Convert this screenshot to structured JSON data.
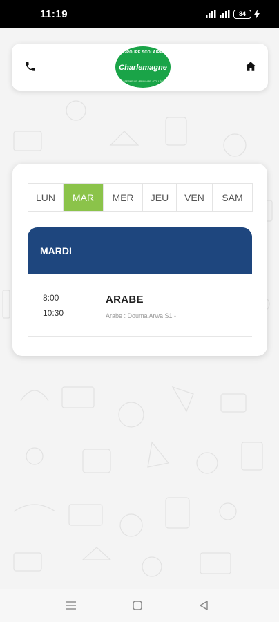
{
  "status_bar": {
    "time": "11:19",
    "battery": "84"
  },
  "header": {
    "logo": {
      "top_text": "GROUPE SCOLAIRE",
      "name": "Charlemagne",
      "bottom_text": "MATERNELLE · PRIMAIRE · COLLÈGE"
    },
    "icons": [
      "phone-icon",
      "home-icon"
    ]
  },
  "schedule": {
    "days": [
      "LUN",
      "MAR",
      "MER",
      "JEU",
      "VEN",
      "SAM"
    ],
    "active_day": "MAR",
    "day_title": "MARDI",
    "lessons": [
      {
        "start": "8:00",
        "end": "10:30",
        "subject": "ARABE",
        "detail": "Arabe : Douma Arwa S1 -"
      }
    ]
  },
  "colors": {
    "accent_green": "#8bc34a",
    "banner_blue": "#1e467e",
    "logo_green": "#1aa448"
  },
  "nav_bar": {
    "icons": [
      "menu-icon",
      "home-square-icon",
      "back-icon"
    ]
  }
}
